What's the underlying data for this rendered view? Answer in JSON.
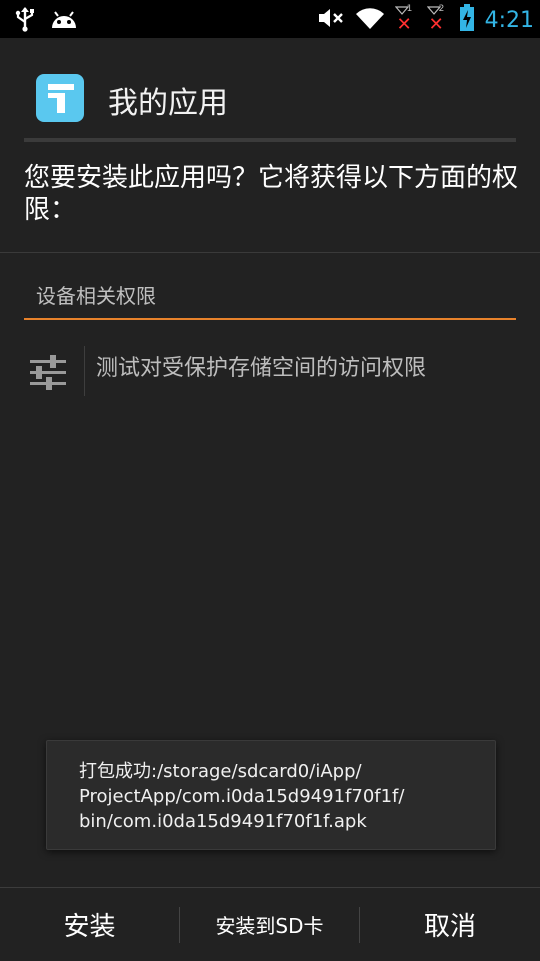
{
  "status_bar": {
    "time": "4:21",
    "sim1_label": "1",
    "sim2_label": "2",
    "icons": [
      "usb-icon",
      "android-debug-icon",
      "mute-icon",
      "wifi-icon",
      "signal-sim1-icon",
      "signal-sim2-icon",
      "battery-charging-icon"
    ],
    "accent_color": "#33b5e5"
  },
  "dialog": {
    "app_name": "我的应用",
    "question": "您要安装此应用吗？它将获得以下方面的权限：",
    "section_title": "设备相关权限",
    "section_accent_color": "#e8822b",
    "permissions": [
      {
        "icon": "settings-sliders-icon",
        "label": "测试对受保护存储空间的访问权限"
      }
    ]
  },
  "toast": {
    "message": "打包成功:/storage/sdcard0/iApp/\nProjectApp/com.i0da15d9491f70f1f/\nbin/com.i0da15d9491f70f1f.apk"
  },
  "buttons": {
    "install": "安装",
    "install_sd": "安装到SD卡",
    "cancel": "取消"
  }
}
